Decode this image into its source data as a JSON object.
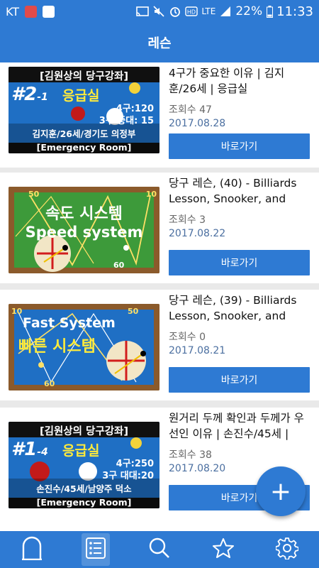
{
  "colors": {
    "primary": "#2e7ad3",
    "background": "#e9e9e9"
  },
  "status_bar": {
    "carrier": "KT",
    "lte": "LTE",
    "battery": "22%",
    "time": "11:33",
    "icons": [
      "cast-icon",
      "mute-icon",
      "alarm-icon",
      "hd-icon",
      "lte-signal-icon",
      "battery-icon"
    ]
  },
  "app_bar": {
    "title": "레슨"
  },
  "lessons": [
    {
      "title": "4구가 중요한 이유 | 김지훈/26세 | 응급실",
      "views": "조회수 47",
      "date": "2017.08.28",
      "button": "바로가기",
      "thumb": {
        "kind": "emergency",
        "line1": "[김원상의 당구강좌]",
        "ep": "#2",
        "ep_sub": "-1",
        "room": "응급실",
        "stat1": "4구:120",
        "stat2": "3구 중대: 15",
        "person": "김지훈/26세/경기도 의정부",
        "footer": "[Emergency Room]"
      }
    },
    {
      "title": "당구 레슨, (40) - Billiards Lesson, Snooker, and",
      "views": "조회수 3",
      "date": "2017.08.22",
      "button": "바로가기",
      "thumb": {
        "kind": "speed",
        "kr": "속도 시스템",
        "en": "Speed system",
        "n1": "50",
        "n2": "10",
        "n3": "60"
      }
    },
    {
      "title": "당구 레슨, (39) - Billiards Lesson, Snooker, and",
      "views": "조회수 0",
      "date": "2017.08.21",
      "button": "바로가기",
      "thumb": {
        "kind": "fast",
        "en": "Fast System",
        "kr": "빠른 시스템",
        "n1": "10",
        "n2": "50",
        "n3": "60"
      }
    },
    {
      "title": "원거리 두께 확인과 두께가 우선인 이유 | 손진수/45세 |",
      "views": "조회수 38",
      "date": "2017.08.20",
      "button": "바로가기",
      "thumb": {
        "kind": "emergency",
        "line1": "[김원상의 당구강좌]",
        "ep": "#1",
        "ep_sub": "-4",
        "room": "응급실",
        "stat1": "4구:250",
        "stat2": "3구 대대:20",
        "person": "손진수/45세/남양주 덕소",
        "footer": "[Emergency Room]"
      }
    }
  ],
  "fab": {
    "label": "+"
  },
  "bottom_nav": [
    {
      "name": "home-icon"
    },
    {
      "name": "list-icon"
    },
    {
      "name": "search-icon"
    },
    {
      "name": "star-icon"
    },
    {
      "name": "settings-icon"
    }
  ]
}
